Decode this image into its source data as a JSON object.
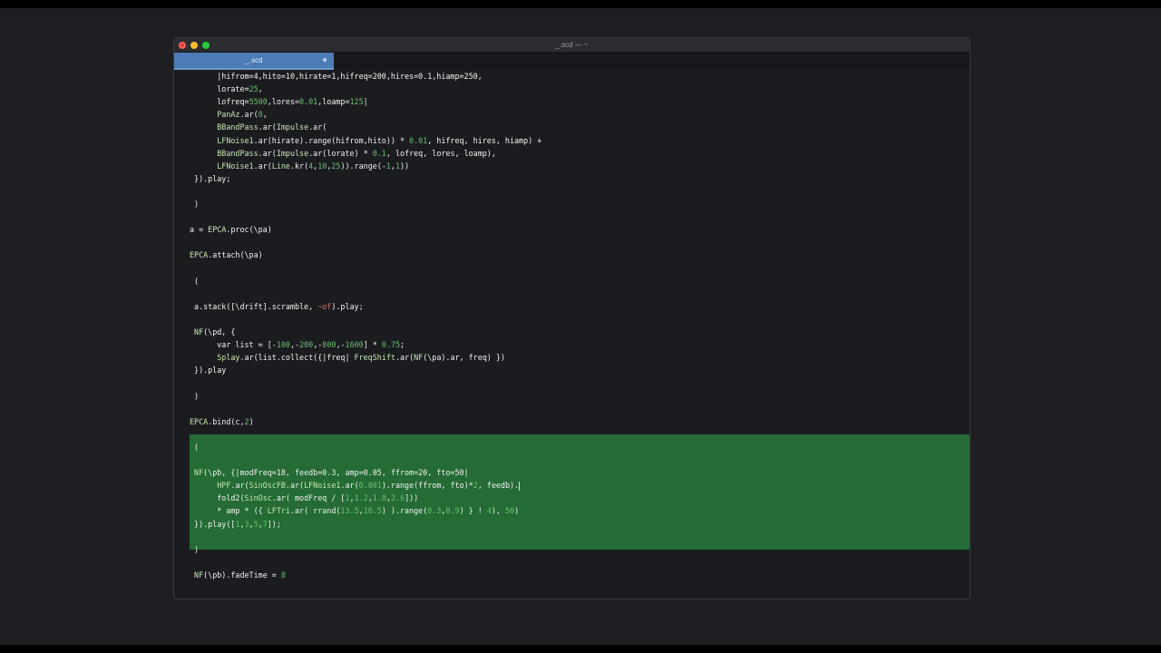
{
  "window": {
    "title": "_.scd — ~",
    "tab": {
      "label": "_.scd"
    }
  },
  "colors": {
    "background": "#1b1c20",
    "tab_active": "#4c7cb6",
    "selection": "#246b35",
    "class_name": "#c5e8b0",
    "number": "#6cc070",
    "symbol": "#e06a60",
    "text": "#f2f2f2"
  },
  "editor": {
    "lines": [
      {
        "indent": "      ",
        "parts": [
          {
            "t": "|hifrom=4,hito=10,hirate=1,hifreq=200,hires=0.1,hiamp=250,"
          }
        ]
      },
      {
        "indent": "      ",
        "parts": [
          {
            "t": "lorate="
          },
          {
            "t": "25",
            "c": "num"
          },
          {
            "t": ","
          }
        ]
      },
      {
        "indent": "      ",
        "parts": [
          {
            "t": "lofreq="
          },
          {
            "t": "5500",
            "c": "num"
          },
          {
            "t": ",lores="
          },
          {
            "t": "0.01",
            "c": "num"
          },
          {
            "t": ",loamp="
          },
          {
            "t": "125",
            "c": "num"
          },
          {
            "t": "|"
          }
        ]
      },
      {
        "indent": "      ",
        "parts": [
          {
            "t": "PanAz",
            "c": "cls"
          },
          {
            "t": ".ar("
          },
          {
            "t": "8",
            "c": "num"
          },
          {
            "t": ","
          }
        ]
      },
      {
        "indent": "      ",
        "parts": [
          {
            "t": "BBandPass",
            "c": "cls"
          },
          {
            "t": ".ar("
          },
          {
            "t": "Impulse",
            "c": "cls"
          },
          {
            "t": ".ar("
          }
        ]
      },
      {
        "indent": "      ",
        "parts": [
          {
            "t": "LFNoise1",
            "c": "cls"
          },
          {
            "t": ".ar(hirate).range(hifrom,hito)) * "
          },
          {
            "t": "0.01",
            "c": "num"
          },
          {
            "t": ", hifreq, hires, hiamp) +"
          }
        ]
      },
      {
        "indent": "      ",
        "parts": [
          {
            "t": "BBandPass",
            "c": "cls"
          },
          {
            "t": ".ar("
          },
          {
            "t": "Impulse",
            "c": "cls"
          },
          {
            "t": ".ar(lorate) * "
          },
          {
            "t": "0.1",
            "c": "num"
          },
          {
            "t": ", lofreq, lores, loamp),"
          }
        ]
      },
      {
        "indent": "      ",
        "parts": [
          {
            "t": "LFNoise1",
            "c": "cls"
          },
          {
            "t": ".ar("
          },
          {
            "t": "Line",
            "c": "cls"
          },
          {
            "t": ".kr("
          },
          {
            "t": "4",
            "c": "num"
          },
          {
            "t": ","
          },
          {
            "t": "10",
            "c": "num"
          },
          {
            "t": ","
          },
          {
            "t": "25",
            "c": "num"
          },
          {
            "t": ")).range(-"
          },
          {
            "t": "1",
            "c": "num"
          },
          {
            "t": ","
          },
          {
            "t": "1",
            "c": "num"
          },
          {
            "t": "))"
          }
        ]
      },
      {
        "indent": " ",
        "parts": [
          {
            "t": "}).play;"
          }
        ]
      },
      {
        "indent": "",
        "parts": []
      },
      {
        "indent": " ",
        "parts": [
          {
            "t": ")"
          }
        ]
      },
      {
        "indent": "",
        "parts": []
      },
      {
        "indent": "",
        "parts": [
          {
            "t": "a = "
          },
          {
            "t": "EPCA",
            "c": "cls"
          },
          {
            "t": ".proc(\\pa)"
          }
        ]
      },
      {
        "indent": "",
        "parts": []
      },
      {
        "indent": "",
        "parts": [
          {
            "t": "EPCA",
            "c": "cls"
          },
          {
            "t": ".attach(\\pa)"
          }
        ]
      },
      {
        "indent": "",
        "parts": []
      },
      {
        "indent": " ",
        "parts": [
          {
            "t": "("
          }
        ]
      },
      {
        "indent": "",
        "parts": []
      },
      {
        "indent": " ",
        "parts": [
          {
            "t": "a.stack([\\drift].scramble, "
          },
          {
            "t": "~of",
            "c": "sym"
          },
          {
            "t": ").play;"
          }
        ]
      },
      {
        "indent": "",
        "parts": []
      },
      {
        "indent": " ",
        "parts": [
          {
            "t": "NF",
            "c": "cls"
          },
          {
            "t": "(\\pd, {"
          }
        ]
      },
      {
        "indent": "      ",
        "parts": [
          {
            "t": "var list = [-"
          },
          {
            "t": "100",
            "c": "num"
          },
          {
            "t": ",-"
          },
          {
            "t": "200",
            "c": "num"
          },
          {
            "t": ",-"
          },
          {
            "t": "800",
            "c": "num"
          },
          {
            "t": ",-"
          },
          {
            "t": "1600",
            "c": "num"
          },
          {
            "t": "] * "
          },
          {
            "t": "0.75",
            "c": "num"
          },
          {
            "t": ";"
          }
        ]
      },
      {
        "indent": "      ",
        "parts": [
          {
            "t": "Splay",
            "c": "cls"
          },
          {
            "t": ".ar(list.collect({|freq| "
          },
          {
            "t": "FreqShift",
            "c": "cls"
          },
          {
            "t": ".ar("
          },
          {
            "t": "NF",
            "c": "cls"
          },
          {
            "t": "(\\pa).ar, freq) })"
          }
        ]
      },
      {
        "indent": " ",
        "parts": [
          {
            "t": "}).play"
          }
        ]
      },
      {
        "indent": "",
        "parts": []
      },
      {
        "indent": " ",
        "parts": [
          {
            "t": ")"
          }
        ]
      },
      {
        "indent": "",
        "parts": []
      },
      {
        "indent": "",
        "parts": [
          {
            "t": "EPCA",
            "c": "cls"
          },
          {
            "t": ".bind(c,"
          },
          {
            "t": "2",
            "c": "num"
          },
          {
            "t": ")"
          }
        ]
      },
      {
        "indent": "",
        "parts": []
      },
      {
        "indent": " ",
        "parts": [
          {
            "t": "("
          }
        ]
      },
      {
        "indent": "",
        "parts": []
      },
      {
        "indent": " ",
        "parts": [
          {
            "t": "NF",
            "c": "cls"
          },
          {
            "t": "(\\pb, {|modFreq=18, feedb=0.3, amp=0.05, ffrom=20, fto=50|"
          }
        ]
      },
      {
        "indent": "      ",
        "parts": [
          {
            "t": "HPF",
            "c": "cls"
          },
          {
            "t": ".ar("
          },
          {
            "t": "SinOscFB",
            "c": "cls"
          },
          {
            "t": ".ar("
          },
          {
            "t": "LFNoise1",
            "c": "cls"
          },
          {
            "t": ".ar("
          },
          {
            "t": "0.001",
            "c": "num"
          },
          {
            "t": ").range(ffrom, fto)*"
          },
          {
            "t": "2",
            "c": "num"
          },
          {
            "t": ", feedb)."
          }
        ]
      },
      {
        "indent": "      ",
        "parts": [
          {
            "t": "fold2("
          },
          {
            "t": "SinOsc",
            "c": "cls"
          },
          {
            "t": ".ar( modFreq / ["
          },
          {
            "t": "1",
            "c": "num"
          },
          {
            "t": ","
          },
          {
            "t": "1.2",
            "c": "num"
          },
          {
            "t": ","
          },
          {
            "t": "1.8",
            "c": "num"
          },
          {
            "t": ","
          },
          {
            "t": "2.6",
            "c": "num"
          },
          {
            "t": "]))"
          }
        ]
      },
      {
        "indent": "      ",
        "parts": [
          {
            "t": "* amp * ({ "
          },
          {
            "t": "LFTri",
            "c": "cls"
          },
          {
            "t": ".ar( rrand("
          },
          {
            "t": "13.5",
            "c": "num"
          },
          {
            "t": ","
          },
          {
            "t": "18.5",
            "c": "num"
          },
          {
            "t": ") ).range("
          },
          {
            "t": "0.3",
            "c": "num"
          },
          {
            "t": ","
          },
          {
            "t": "0.9",
            "c": "num"
          },
          {
            "t": ") } ! "
          },
          {
            "t": "4",
            "c": "num"
          },
          {
            "t": "), "
          },
          {
            "t": "50",
            "c": "num"
          },
          {
            "t": ")"
          }
        ]
      },
      {
        "indent": " ",
        "parts": [
          {
            "t": "}).play(["
          },
          {
            "t": "1",
            "c": "num"
          },
          {
            "t": ","
          },
          {
            "t": "3",
            "c": "num"
          },
          {
            "t": ","
          },
          {
            "t": "5",
            "c": "num"
          },
          {
            "t": ","
          },
          {
            "t": "7",
            "c": "num"
          },
          {
            "t": "]);"
          }
        ]
      },
      {
        "indent": "",
        "parts": []
      },
      {
        "indent": " ",
        "parts": [
          {
            "t": ")"
          }
        ]
      },
      {
        "indent": "",
        "parts": []
      },
      {
        "indent": " ",
        "parts": [
          {
            "t": "NF",
            "c": "cls"
          },
          {
            "t": "(\\pb).fadeTime = "
          },
          {
            "t": "8",
            "c": "num"
          }
        ]
      }
    ]
  }
}
